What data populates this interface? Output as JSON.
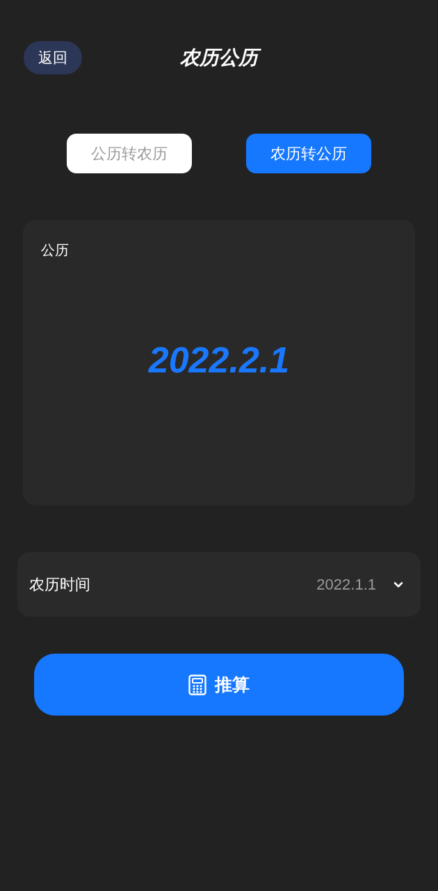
{
  "header": {
    "back_button": "返回",
    "title": "农历公历"
  },
  "tabs": [
    {
      "label": "公历转农历",
      "selected": false
    },
    {
      "label": "农历转公历",
      "selected": true
    }
  ],
  "result": {
    "label": "公历",
    "value": "2022.2.1"
  },
  "picker": {
    "label": "农历时间",
    "value": "2022.1.1"
  },
  "action_button": {
    "label": "推算"
  }
}
